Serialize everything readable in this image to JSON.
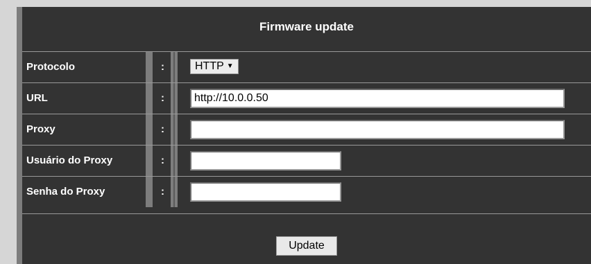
{
  "header": {
    "title": "Firmware update"
  },
  "rows": [
    {
      "label": "Protocolo",
      "colon": ":",
      "type": "select",
      "value": "HTTP",
      "arrow": "▼"
    },
    {
      "label": "URL",
      "colon": ":",
      "type": "text",
      "value": "http://10.0.0.50"
    },
    {
      "label": "Proxy",
      "colon": ":",
      "type": "text",
      "value": ""
    },
    {
      "label": "Usuário do Proxy",
      "colon": ":",
      "type": "text",
      "value": ""
    },
    {
      "label": "Senha do Proxy",
      "colon": ":",
      "type": "password",
      "value": ""
    }
  ],
  "footer": {
    "update_label": "Update"
  },
  "colors": {
    "panel": "#333333",
    "separator": "#7d7d7d",
    "page_background": "#d6d6d6",
    "text": "#ffffff"
  }
}
